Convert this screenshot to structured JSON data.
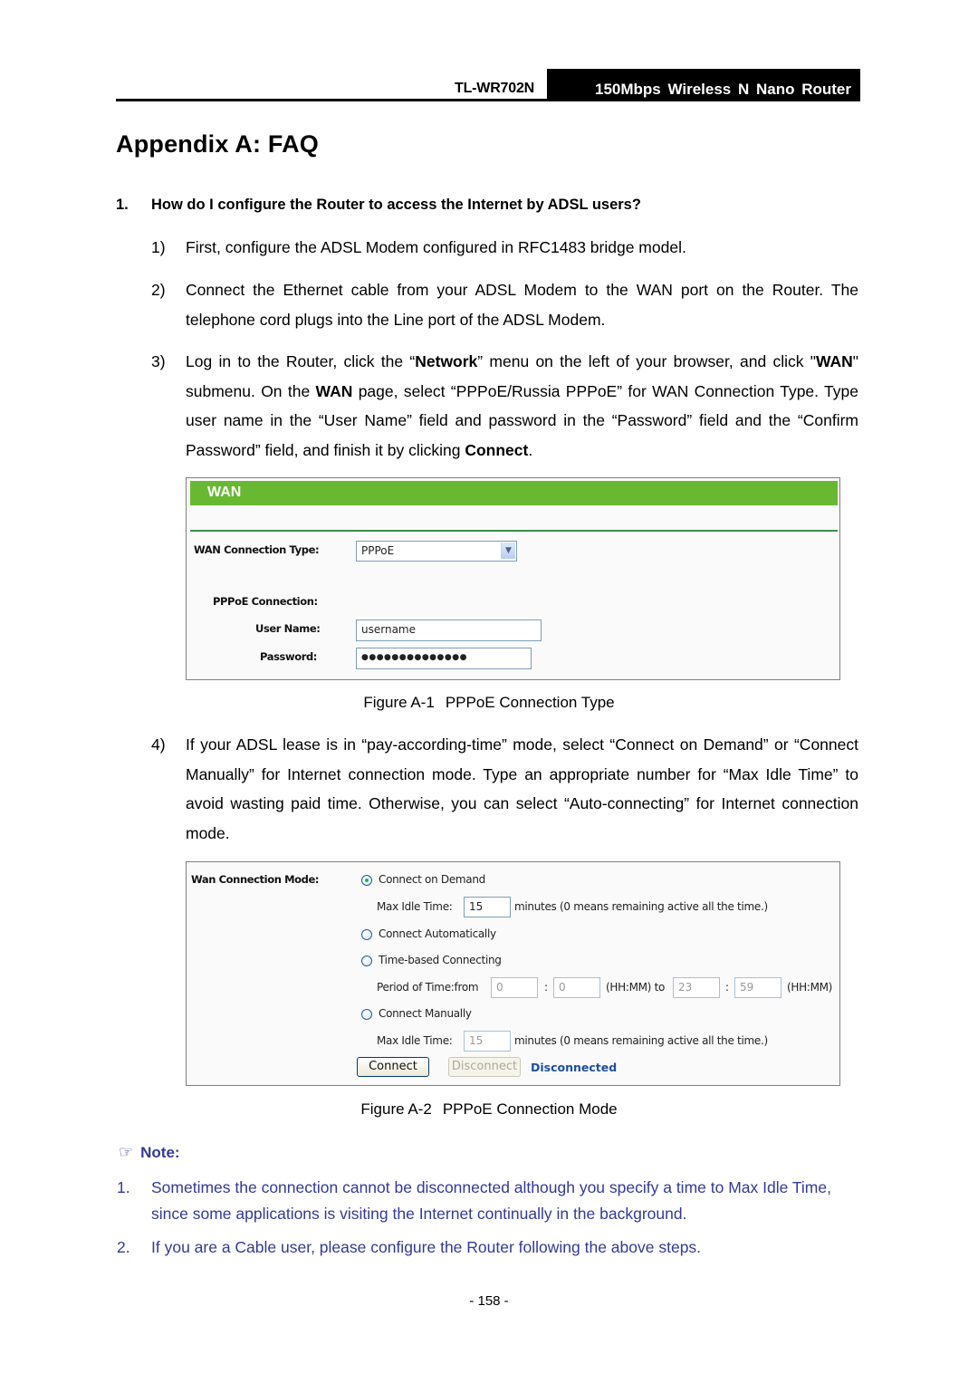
{
  "header": {
    "model": "TL-WR702N",
    "product": "150Mbps  Wireless  N  Nano  Router"
  },
  "title": "Appendix A: FAQ",
  "question": {
    "number": "1.",
    "text": "How do I configure the Router to access the Internet by ADSL users?"
  },
  "steps": [
    {
      "n": "1)",
      "text": "First, configure the ADSL Modem configured in RFC1483 bridge model."
    },
    {
      "n": "2)",
      "text": "Connect the Ethernet cable from your ADSL Modem to the WAN port on the Router. The telephone cord plugs into the Line port of the ADSL Modem."
    },
    {
      "n": "3)",
      "parts": [
        "Log in to the Router, click the “",
        "Network",
        "” menu on the left of your browser, and click \"",
        "WAN",
        "\" submenu. On the ",
        "WAN",
        " page, select “PPPoE/Russia PPPoE” for WAN Connection Type. Type user name in the “User Name” field and password in the “Password” field and the “Confirm Password” field, and finish it by clicking ",
        "Connect",
        "."
      ]
    },
    {
      "n": "4)",
      "text": "If your ADSL lease is in “pay-according-time” mode, select “Connect on Demand” or “Connect Manually” for Internet connection mode. Type an appropriate number for “Max Idle Time” to avoid wasting paid time. Otherwise, you can select “Auto-connecting” for Internet connection mode."
    }
  ],
  "figure1": {
    "bar_title": "WAN",
    "bar_color": "#69b832",
    "wan_type_label": "WAN Connection Type:",
    "wan_type_value": "PPPoE",
    "pppoe_label": "PPPoE Connection:",
    "username_label": "User Name:",
    "username_value": "username",
    "password_label": "Password:",
    "password_value": "●●●●●●●●●●●●●●",
    "caption_num": "Figure A-1",
    "caption_text": "PPPoE Connection Type"
  },
  "figure2": {
    "mode_label": "Wan Connection Mode:",
    "options": {
      "demand": "Connect on Demand",
      "auto": "Connect Automatically",
      "time": "Time-based Connecting",
      "manual": "Connect Manually"
    },
    "selected": "demand",
    "max_idle_label": "Max Idle Time:",
    "max_idle_demand": "15",
    "max_idle_manual": "15",
    "minutes_hint": "minutes (0 means remaining active all the time.)",
    "period_label": "Period of Time:from",
    "from_hh": "0",
    "from_mm": "0",
    "colon": ":",
    "hhmm_to": "(HH:MM) to",
    "to_hh": "23",
    "to_mm": "59",
    "hhmm": "(HH:MM)",
    "connect_btn": "Connect",
    "disconnect_btn": "Disconnect",
    "status": "Disconnected",
    "caption_num": "Figure A-2",
    "caption_text": "PPPoE Connection Mode"
  },
  "note": {
    "icon": "☞",
    "heading": "Note:",
    "color": "#333a99",
    "items": [
      {
        "n": "1.",
        "text": "Sometimes the connection cannot be disconnected although you specify a time to Max Idle Time, since some applications is visiting the Internet continually in the background."
      },
      {
        "n": "2.",
        "text": "If you are a Cable user, please configure the Router following the above steps."
      }
    ]
  },
  "page_number": "- 158 -"
}
